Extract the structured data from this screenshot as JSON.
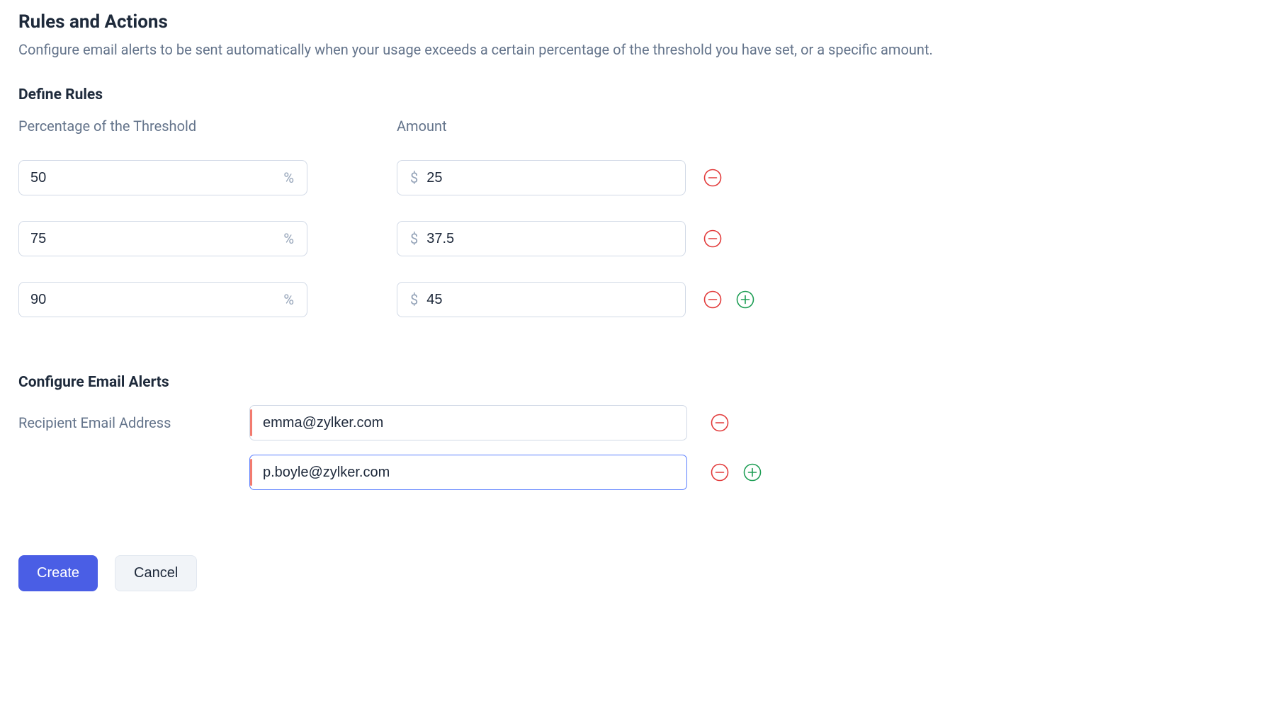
{
  "header": {
    "title": "Rules and Actions",
    "subtitle": "Configure email alerts to be sent automatically when your usage exceeds a certain percentage of the threshold you have set, or a specific amount."
  },
  "rules": {
    "heading": "Define Rules",
    "percent_label": "Percentage of the Threshold",
    "amount_label": "Amount",
    "percent_symbol": "%",
    "currency_symbol": "$",
    "rows": [
      {
        "percent": "50",
        "amount": "25"
      },
      {
        "percent": "75",
        "amount": "37.5"
      },
      {
        "percent": "90",
        "amount": "45"
      }
    ]
  },
  "emails": {
    "heading": "Configure Email Alerts",
    "label": "Recipient Email Address",
    "rows": [
      {
        "value": "emma@zylker.com",
        "focused": false
      },
      {
        "value": "p.boyle@zylker.com",
        "focused": true
      }
    ]
  },
  "buttons": {
    "create": "Create",
    "cancel": "Cancel"
  },
  "colors": {
    "remove": "#e23b3b",
    "add": "#1e9e55"
  }
}
